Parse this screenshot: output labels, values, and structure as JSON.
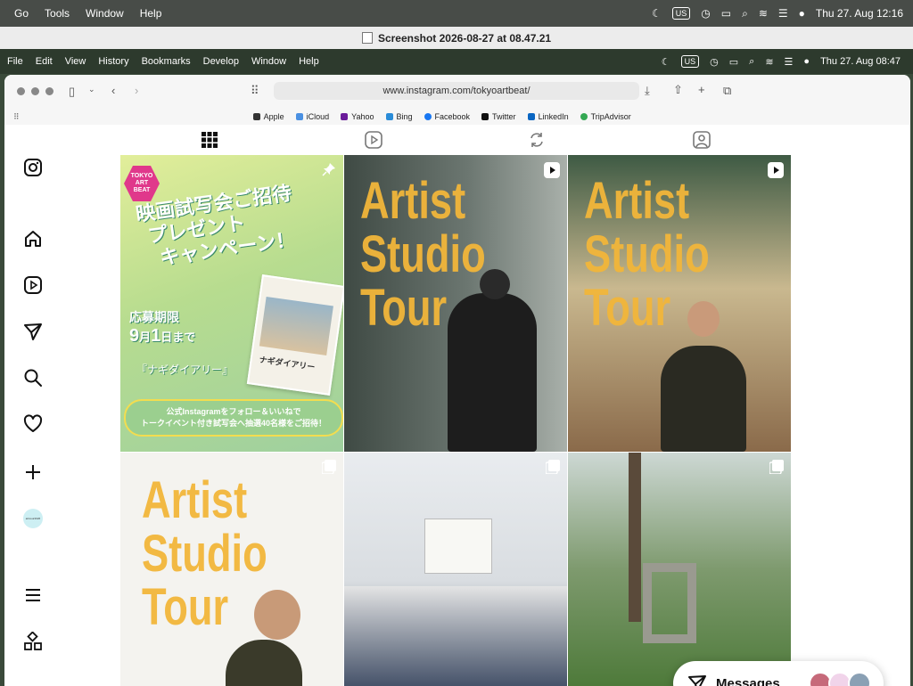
{
  "system_menubar": {
    "menus": [
      "Go",
      "Tools",
      "Window",
      "Help"
    ],
    "keyboard": "US",
    "datetime": "Thu 27. Aug  12:16"
  },
  "window_title": "Screenshot 2026-08-27 at 08.47.21",
  "inner_menubar": {
    "menus": [
      "File",
      "Edit",
      "View",
      "History",
      "Bookmarks",
      "Develop",
      "Window",
      "Help"
    ],
    "keyboard": "US",
    "datetime": "Thu 27. Aug  08:47"
  },
  "browser": {
    "url": "www.instagram.com/tokyoartbeat/",
    "bookmarks": [
      "Apple",
      "iCloud",
      "Yahoo",
      "Bing",
      "Facebook",
      "Twitter",
      "LinkedIn",
      "TripAdvisor"
    ]
  },
  "sidebar": {
    "icons": [
      "instagram-logo-icon",
      "home-icon",
      "reels-icon",
      "send-icon",
      "search-icon",
      "heart-icon",
      "create-icon",
      "profile-avatar",
      "menu-icon",
      "more-apps-icon"
    ],
    "avatar_label": "art•tour2026"
  },
  "profile_tabs": [
    "posts-grid-icon",
    "reels-tab-icon",
    "tagged-repost-icon",
    "tagged-person-icon"
  ],
  "posts": {
    "promo": {
      "logo": [
        "TOKYO",
        "ART",
        "BEAT"
      ],
      "headline": [
        "映画試写会ご招待",
        "プレゼント",
        "キャンペーン！"
      ],
      "deadline_label": "応募期限",
      "deadline_month": "9",
      "deadline_month_suffix": "月",
      "deadline_day": "1",
      "deadline_day_suffix": "日まで",
      "movie_title": "『ナギダイアリー』",
      "poster_title": "ナギダイアリー",
      "cta_line1": "公式Instagramをフォロー＆いいねで",
      "cta_line2": "トークイベント付き試写会へ抽選40名様をご招待！"
    },
    "studio_text": [
      "Artist",
      "Studio",
      "Tour"
    ]
  },
  "messages": {
    "label": "Messages"
  },
  "colors": {
    "instagram_text": "#111111",
    "studio_yellow": "#f2b63a",
    "logo_pink": "#e0388b"
  }
}
